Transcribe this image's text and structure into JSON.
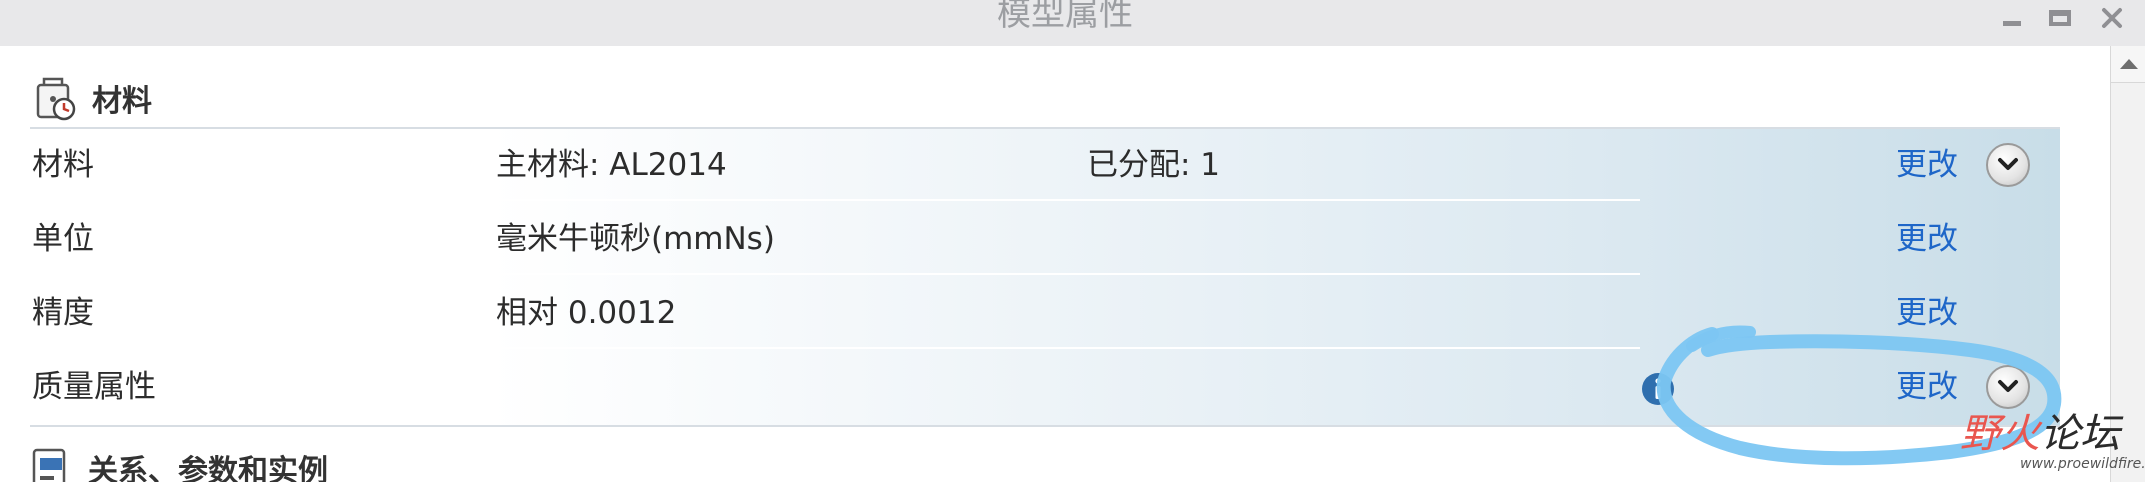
{
  "window": {
    "title": "模型属性"
  },
  "material_section": {
    "title": "材料",
    "rows": [
      {
        "label": "材料",
        "value": "主材料: AL2014",
        "extra": "已分配: 1",
        "action": "更改",
        "expandable": true,
        "info": false
      },
      {
        "label": "单位",
        "value": "毫米牛顿秒(mmNs)",
        "extra": "",
        "action": "更改",
        "expandable": false,
        "info": false
      },
      {
        "label": "精度",
        "value": "相对 0.0012",
        "extra": "",
        "action": "更改",
        "expandable": false,
        "info": false
      },
      {
        "label": "质量属性",
        "value": "",
        "extra": "",
        "action": "更改",
        "expandable": true,
        "info": true
      }
    ]
  },
  "next_section": {
    "title": "关系、参数和实例"
  },
  "watermark": {
    "brand_a": "野火",
    "brand_b": "论坛",
    "url": "www.proewildfire.cn"
  },
  "colors": {
    "link": "#1e66c8",
    "annotation": "#7cc6f2",
    "watermark_red": "#e9564f"
  },
  "icons": {
    "material": "material-tag-icon",
    "relations": "relations-icon",
    "expand": "chevron-down-icon",
    "info": "info-icon"
  }
}
